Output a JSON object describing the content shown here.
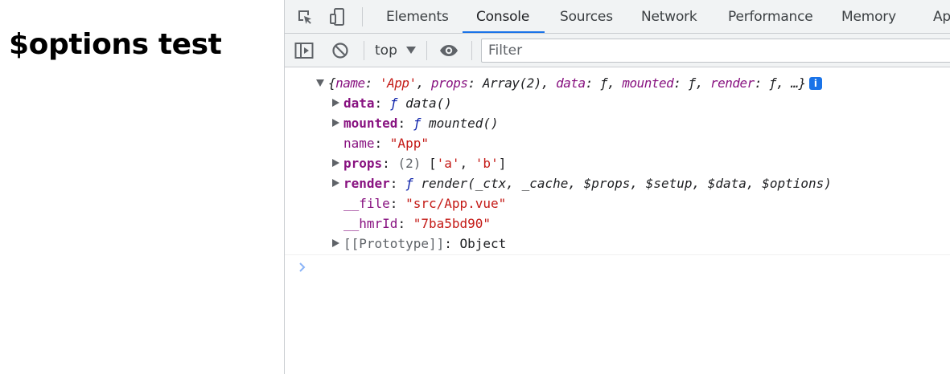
{
  "page": {
    "heading": "$options test"
  },
  "devtools": {
    "tabs": [
      {
        "label": "Elements"
      },
      {
        "label": "Console",
        "active": true
      },
      {
        "label": "Sources"
      },
      {
        "label": "Network"
      },
      {
        "label": "Performance"
      },
      {
        "label": "Memory"
      },
      {
        "label": "Application"
      }
    ],
    "toolbar": {
      "context": "top",
      "filter_placeholder": "Filter"
    },
    "console": {
      "summary": {
        "open": "{",
        "name_key": "name",
        "name_val": "'App'",
        "props_key": "props",
        "props_val": "Array(2)",
        "data_key": "data",
        "data_val": "ƒ",
        "mounted_key": "mounted",
        "mounted_val": "ƒ",
        "render_key": "render",
        "render_val": "ƒ",
        "close": "…}",
        "info": "i"
      },
      "data_row": {
        "key": "data",
        "fn": "ƒ",
        "sig": "data()"
      },
      "mounted_row": {
        "key": "mounted",
        "fn": "ƒ",
        "sig": "mounted()"
      },
      "name_row": {
        "key": "name",
        "value": "\"App\""
      },
      "props_row": {
        "key": "props",
        "count": "(2)",
        "open": "[",
        "a": "'a'",
        "b": "'b'",
        "close": "]"
      },
      "render_row": {
        "key": "render",
        "fn": "ƒ",
        "sig": "render(_ctx, _cache, $props, $setup, $data, $options)"
      },
      "file_row": {
        "key": "__file",
        "value": "\"src/App.vue\""
      },
      "hmr_row": {
        "key": "__hmrId",
        "value": "\"7ba5bd90\""
      },
      "proto_row": {
        "key": "[[Prototype]]",
        "value": "Object"
      }
    },
    "colors": {
      "tab_underline": "#1a73e8",
      "key": "#881280",
      "string": "#c41a16",
      "function_keyword": "#0d22aa",
      "info_badge": "#1a73e8",
      "prompt": "#1a73e8"
    }
  }
}
